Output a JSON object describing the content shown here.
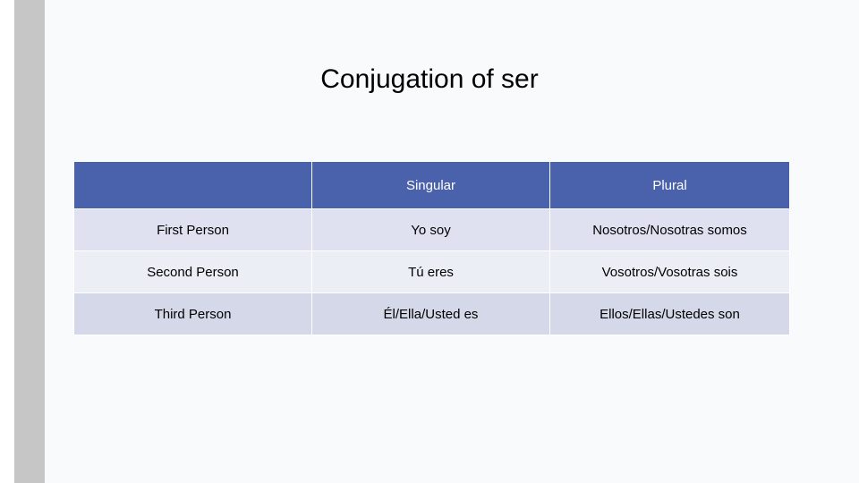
{
  "slide": {
    "title": "Conjugation of ser"
  },
  "table": {
    "headers": [
      "",
      "Singular",
      "Plural"
    ],
    "rows": [
      [
        "First Person",
        "Yo soy",
        "Nosotros/Nosotras somos"
      ],
      [
        "Second Person",
        "Tú eres",
        "Vosotros/Vosotras sois"
      ],
      [
        "Third Person",
        "Él/Ella/Usted es",
        "Ellos/Ellas/Ustedes son"
      ]
    ]
  },
  "colors": {
    "header_background": "#4a61ab",
    "header_text": "#ffffff",
    "row_a": "#dfe1f0",
    "row_b": "#eceef6",
    "row_c": "#d5d8e8",
    "slide_background": "#f9fafc",
    "gutter": "#c6c6c6"
  }
}
